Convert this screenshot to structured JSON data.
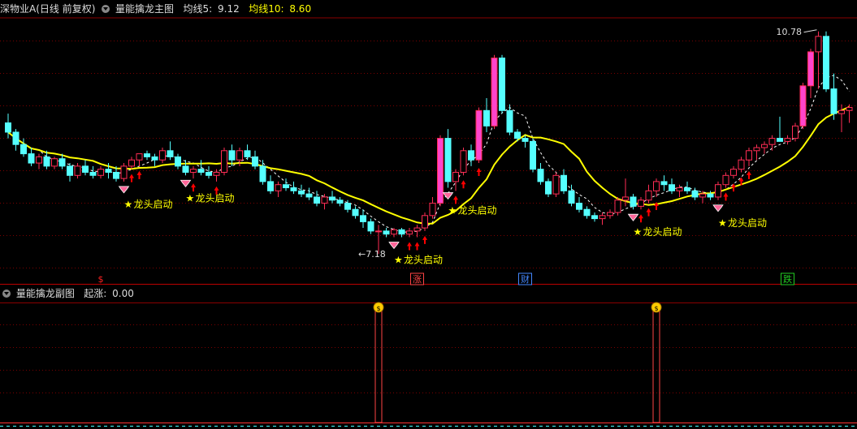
{
  "main_header": {
    "stock_label": "深物业A(日线 前复权)",
    "indicator_name": "量能擒龙主图",
    "ma5_label": "均线5:",
    "ma5_value": "9.12",
    "ma10_label": "均线10:",
    "ma10_value": "8.60"
  },
  "sub_header": {
    "indicator_name": "量能擒龙副图",
    "rise_label": "起涨:",
    "rise_value": "0.00"
  },
  "colors": {
    "background": "#000000",
    "grid": "#7a0000",
    "up_candle": "#ff2d55",
    "up_fill": "#ff44cc",
    "down_candle": "#55ffff",
    "ma_yellow": "#ffff00",
    "ma_white_dashed": "#ffffff",
    "signal_star": "#ffff00",
    "signal_arrow": "#ff0000",
    "sub_bar": "#ff4444"
  },
  "chart_data": [
    {
      "type": "candlestick",
      "title": "量能擒龙主图",
      "ylim": [
        6.8,
        11.0
      ],
      "price_labels": {
        "high": "10.78",
        "low": "7.18"
      },
      "candles": [
        [
          9.3,
          9.45,
          9.05,
          9.15
        ],
        [
          9.15,
          9.2,
          8.85,
          8.95
        ],
        [
          8.95,
          9.05,
          8.75,
          8.8
        ],
        [
          8.8,
          8.9,
          8.6,
          8.65
        ],
        [
          8.65,
          8.8,
          8.55,
          8.75
        ],
        [
          8.75,
          8.85,
          8.55,
          8.6
        ],
        [
          8.6,
          8.75,
          8.55,
          8.72
        ],
        [
          8.72,
          8.8,
          8.55,
          8.6
        ],
        [
          8.6,
          8.65,
          8.35,
          8.45
        ],
        [
          8.45,
          8.65,
          8.4,
          8.6
        ],
        [
          8.6,
          8.7,
          8.45,
          8.5
        ],
        [
          8.5,
          8.6,
          8.4,
          8.45
        ],
        [
          8.45,
          8.6,
          8.4,
          8.55
        ],
        [
          8.55,
          8.65,
          8.4,
          8.5
        ],
        [
          8.5,
          8.6,
          8.35,
          8.4
        ],
        [
          8.4,
          8.65,
          8.35,
          8.6
        ],
        [
          8.6,
          8.75,
          8.55,
          8.7
        ],
        [
          8.7,
          8.8,
          8.6,
          8.8
        ],
        [
          8.8,
          8.85,
          8.7,
          8.75
        ],
        [
          8.75,
          8.8,
          8.6,
          8.7
        ],
        [
          8.7,
          8.9,
          8.65,
          8.85
        ],
        [
          8.85,
          9.0,
          8.7,
          8.75
        ],
        [
          8.75,
          8.8,
          8.55,
          8.6
        ],
        [
          8.6,
          8.7,
          8.45,
          8.5
        ],
        [
          8.5,
          8.6,
          8.4,
          8.55
        ],
        [
          8.55,
          8.7,
          8.45,
          8.5
        ],
        [
          8.5,
          8.6,
          8.4,
          8.45
        ],
        [
          8.45,
          8.55,
          8.35,
          8.5
        ],
        [
          8.5,
          8.9,
          8.45,
          8.85
        ],
        [
          8.85,
          8.95,
          8.6,
          8.7
        ],
        [
          8.7,
          8.9,
          8.6,
          8.85
        ],
        [
          8.85,
          8.95,
          8.7,
          8.75
        ],
        [
          8.75,
          8.85,
          8.55,
          8.6
        ],
        [
          8.6,
          8.7,
          8.3,
          8.35
        ],
        [
          8.35,
          8.45,
          8.15,
          8.2
        ],
        [
          8.2,
          8.35,
          8.1,
          8.3
        ],
        [
          8.3,
          8.4,
          8.2,
          8.25
        ],
        [
          8.25,
          8.35,
          8.15,
          8.2
        ],
        [
          8.2,
          8.3,
          8.1,
          8.15
        ],
        [
          8.15,
          8.25,
          8.05,
          8.1
        ],
        [
          8.1,
          8.2,
          7.95,
          8.0
        ],
        [
          8.0,
          8.15,
          7.9,
          8.1
        ],
        [
          8.1,
          8.2,
          8.0,
          8.05
        ],
        [
          8.05,
          8.1,
          7.95,
          8.0
        ],
        [
          8.0,
          8.05,
          7.85,
          7.9
        ],
        [
          7.9,
          7.95,
          7.75,
          7.8
        ],
        [
          7.8,
          7.9,
          7.6,
          7.7
        ],
        [
          7.7,
          7.75,
          7.5,
          7.55
        ],
        [
          7.55,
          7.65,
          7.18,
          7.55
        ],
        [
          7.55,
          7.6,
          7.45,
          7.5
        ],
        [
          7.5,
          7.6,
          7.45,
          7.57
        ],
        [
          7.57,
          7.6,
          7.45,
          7.5
        ],
        [
          7.5,
          7.6,
          7.45,
          7.55
        ],
        [
          7.55,
          7.65,
          7.45,
          7.6
        ],
        [
          7.6,
          7.85,
          7.55,
          7.8
        ],
        [
          7.8,
          8.1,
          7.75,
          8.0
        ],
        [
          8.0,
          9.1,
          7.95,
          9.05
        ],
        [
          9.05,
          9.2,
          8.25,
          8.35
        ],
        [
          8.35,
          8.55,
          8.2,
          8.5
        ],
        [
          8.5,
          8.9,
          8.45,
          8.85
        ],
        [
          8.85,
          8.95,
          8.6,
          8.7
        ],
        [
          8.7,
          9.55,
          8.65,
          9.5
        ],
        [
          9.5,
          9.7,
          9.15,
          9.25
        ],
        [
          9.25,
          10.4,
          9.2,
          10.35
        ],
        [
          10.35,
          10.4,
          9.45,
          9.5
        ],
        [
          9.5,
          9.6,
          9.1,
          9.15
        ],
        [
          9.15,
          9.2,
          9.0,
          9.05
        ],
        [
          9.05,
          9.1,
          8.9,
          9.0
        ],
        [
          9.0,
          9.05,
          8.5,
          8.55
        ],
        [
          8.55,
          8.65,
          8.3,
          8.35
        ],
        [
          8.35,
          8.4,
          8.1,
          8.15
        ],
        [
          8.15,
          8.5,
          8.1,
          8.45
        ],
        [
          8.45,
          8.55,
          8.15,
          8.2
        ],
        [
          8.2,
          8.3,
          7.95,
          8.0
        ],
        [
          8.0,
          8.1,
          7.85,
          7.9
        ],
        [
          7.9,
          7.95,
          7.75,
          7.8
        ],
        [
          7.8,
          7.85,
          7.7,
          7.75
        ],
        [
          7.75,
          7.85,
          7.65,
          7.8
        ],
        [
          7.8,
          7.9,
          7.75,
          7.85
        ],
        [
          7.85,
          8.1,
          7.8,
          8.05
        ],
        [
          8.05,
          8.4,
          7.95,
          8.1
        ],
        [
          8.1,
          8.15,
          7.9,
          7.95
        ],
        [
          7.95,
          8.1,
          7.9,
          8.05
        ],
        [
          8.05,
          8.3,
          8.0,
          8.2
        ],
        [
          8.2,
          8.4,
          8.1,
          8.35
        ],
        [
          8.35,
          8.45,
          8.2,
          8.3
        ],
        [
          8.3,
          8.4,
          8.15,
          8.2
        ],
        [
          8.2,
          8.3,
          8.1,
          8.25
        ],
        [
          8.25,
          8.35,
          8.15,
          8.2
        ],
        [
          8.2,
          8.25,
          8.05,
          8.1
        ],
        [
          8.1,
          8.2,
          8.0,
          8.15
        ],
        [
          8.15,
          8.2,
          8.05,
          8.1
        ],
        [
          8.1,
          8.35,
          8.05,
          8.3
        ],
        [
          8.3,
          8.5,
          8.25,
          8.45
        ],
        [
          8.45,
          8.6,
          8.4,
          8.55
        ],
        [
          8.55,
          8.75,
          8.5,
          8.7
        ],
        [
          8.7,
          8.9,
          8.6,
          8.85
        ],
        [
          8.85,
          8.95,
          8.7,
          8.9
        ],
        [
          8.9,
          9.0,
          8.8,
          8.95
        ],
        [
          8.95,
          9.1,
          8.85,
          9.05
        ],
        [
          9.05,
          9.4,
          9.0,
          9.0
        ],
        [
          9.0,
          9.1,
          8.95,
          9.05
        ],
        [
          9.05,
          9.3,
          9.0,
          9.25
        ],
        [
          9.25,
          9.95,
          9.2,
          9.9
        ],
        [
          9.9,
          10.5,
          9.7,
          10.45
        ],
        [
          10.45,
          10.78,
          9.85,
          10.7
        ],
        [
          10.7,
          10.78,
          9.8,
          9.85
        ],
        [
          9.85,
          10.1,
          9.35,
          9.45
        ],
        [
          9.45,
          9.6,
          9.15,
          9.5
        ],
        [
          9.5,
          9.6,
          9.3,
          9.55
        ]
      ],
      "signals": [
        {
          "index": 15,
          "label": "龙头启动"
        },
        {
          "index": 23,
          "label": "龙头启动"
        },
        {
          "index": 50,
          "label": "龙头启动"
        },
        {
          "index": 57,
          "label": "龙头启动"
        },
        {
          "index": 81,
          "label": "龙头启动"
        },
        {
          "index": 92,
          "label": "龙头启动"
        }
      ],
      "event_markers": [
        {
          "index": 12,
          "label": "$",
          "color": "#ff2222"
        },
        {
          "index": 53,
          "label": "涨",
          "color": "#ff4444"
        },
        {
          "index": 67,
          "label": "财",
          "color": "#4488ff"
        },
        {
          "index": 101,
          "label": "跌",
          "color": "#22cc22"
        }
      ]
    },
    {
      "type": "bar",
      "title": "量能擒龙副图",
      "ylim": [
        0,
        1
      ],
      "bars": [
        {
          "index": 48,
          "value": 1
        },
        {
          "index": 84,
          "value": 1
        }
      ]
    }
  ]
}
